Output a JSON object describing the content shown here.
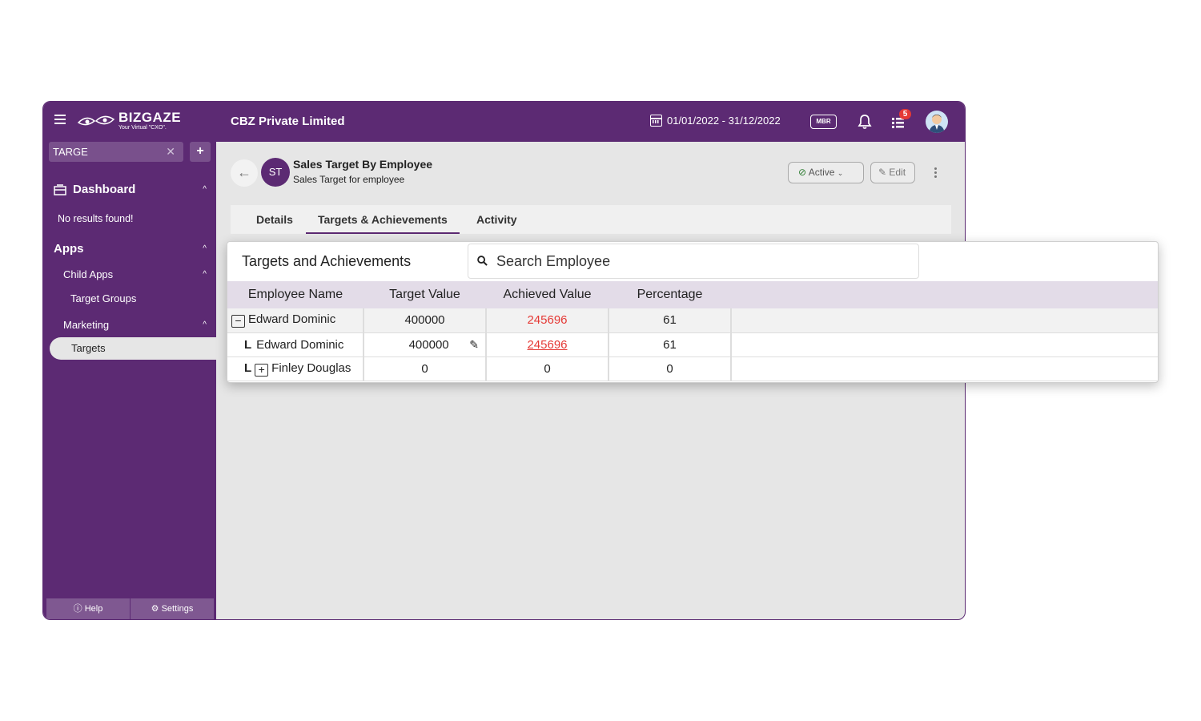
{
  "header": {
    "logo_text": "BIZGAZE",
    "logo_tagline": "Your Virtual \"CXO\".",
    "company": "CBZ Private Limited",
    "date_range": "01/01/2022 - 31/12/2022",
    "mbr_label": "MBR",
    "notification_count": "5"
  },
  "sidebar": {
    "search_value": "TARGE",
    "dashboard": "Dashboard",
    "no_results": "No results found!",
    "apps": "Apps",
    "child_apps": "Child Apps",
    "target_groups": "Target Groups",
    "marketing": "Marketing",
    "targets": "Targets",
    "help": "Help",
    "settings": "Settings"
  },
  "record": {
    "initials": "ST",
    "title": "Sales Target By Employee",
    "subtitle": "Sales Target for employee",
    "status": "Active",
    "edit": "Edit"
  },
  "tabs": [
    "Details",
    "Targets & Achievements",
    "Activity"
  ],
  "panel": {
    "title": "Targets and Achievements",
    "search_placeholder": "Search Employee",
    "columns": [
      "Employee Name",
      "Target Value",
      "Achieved Value",
      "Percentage"
    ],
    "rows": [
      {
        "toggle": "−",
        "name": "Edward Dominic",
        "target": "400000",
        "achieved": "245696",
        "percentage": "61"
      },
      {
        "branch": "L",
        "name": "Edward Dominic",
        "target": "400000",
        "achieved": "245696",
        "percentage": "61"
      },
      {
        "branch": "L",
        "toggle": "+",
        "name": "Finley Douglas",
        "target": "0",
        "achieved": "0",
        "percentage": "0"
      }
    ]
  },
  "colors": {
    "brand": "#5c2a73",
    "achieved": "#e53935",
    "header_row": "#e3dce8"
  }
}
